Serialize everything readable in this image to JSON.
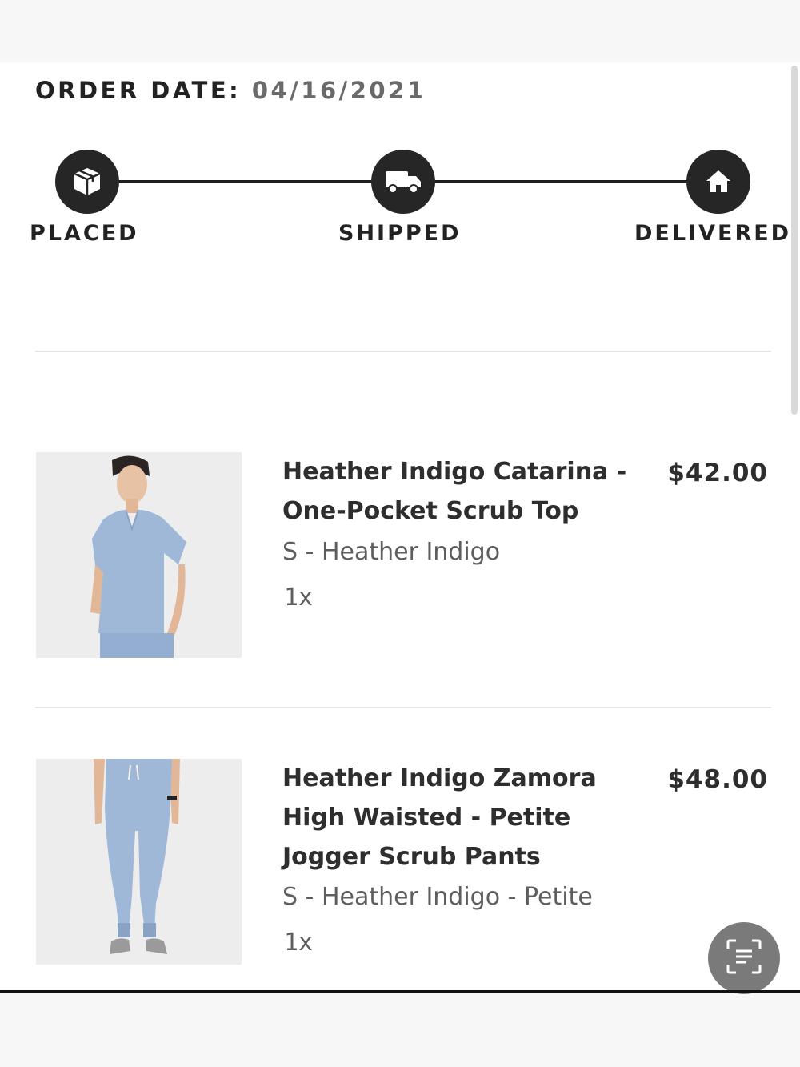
{
  "order": {
    "date_label": "ORDER DATE:",
    "date_value": "04/16/2021"
  },
  "tracker": {
    "steps": [
      {
        "label": "PLACED",
        "icon": "package-icon"
      },
      {
        "label": "SHIPPED",
        "icon": "truck-icon"
      },
      {
        "label": "DELIVERED",
        "icon": "home-icon"
      }
    ]
  },
  "items": [
    {
      "name": "Heather Indigo Catarina - One-Pocket Scrub Top",
      "variant": "S - Heather Indigo",
      "quantity": "1x",
      "price": "$42.00",
      "image": "scrub-top-photo"
    },
    {
      "name": "Heather Indigo Zamora High Waisted - Petite Jogger Scrub Pants",
      "variant": "S - Heather Indigo - Petite",
      "quantity": "1x",
      "price": "$48.00",
      "image": "scrub-pants-photo"
    }
  ],
  "colors": {
    "accent": "#262626",
    "product_blue": "#9fb8d8"
  },
  "floating_action": {
    "icon": "scan-text-icon"
  }
}
